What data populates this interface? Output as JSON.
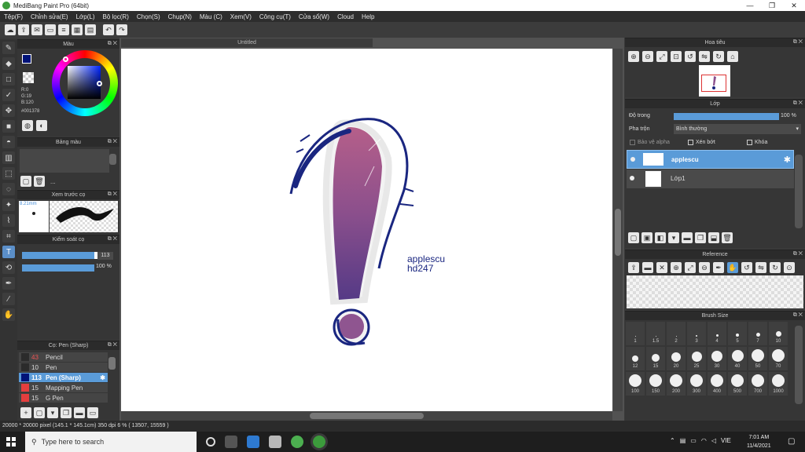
{
  "window": {
    "title": "MediBang Paint Pro (64bit)",
    "min": "—",
    "restore": "❐",
    "close": "✕"
  },
  "menu": [
    "Tệp(F)",
    "Chỉnh sửa(E)",
    "Lớp(L)",
    "Bộ lọc(R)",
    "Chọn(S)",
    "Chụp(N)",
    "Màu (C)",
    "Xem(V)",
    "Công cụ(T)",
    "Cửa sổ(W)",
    "Cloud",
    "Help"
  ],
  "canvas": {
    "tab_title": "Untitled",
    "text_line1": "applescu",
    "text_line2": "hd247"
  },
  "color_panel": {
    "title": "Màu",
    "r": "R:0",
    "g": "G:19",
    "b": "B:120",
    "hex": "#001378",
    "fg_color": "#001378",
    "bg_color": "#e43e3e"
  },
  "palette_panel": {
    "title": "Bảng màu",
    "more": "..."
  },
  "brush_preview_panel": {
    "title": "Xem trước cọ",
    "size": "8.21mm"
  },
  "brush_control_panel": {
    "title": "Kiểm soát cọ",
    "size_value": "113",
    "opacity_value": "100 %"
  },
  "brush_list_panel": {
    "title": "Cọ: Pen (Sharp)",
    "items": [
      {
        "size": "43",
        "name": "Pencil",
        "color": "#2b2b2b"
      },
      {
        "size": "10",
        "name": "Pen",
        "color": "#2b2b2b"
      },
      {
        "size": "113",
        "name": "Pen (Sharp)",
        "color": "#001378"
      },
      {
        "size": "15",
        "name": "Mapping Pen",
        "color": "#e43e3e"
      },
      {
        "size": "15",
        "name": "G Pen",
        "color": "#e43e3e"
      }
    ]
  },
  "navigator_panel": {
    "title": "Hoa tiêu"
  },
  "layer_panel": {
    "title": "Lớp",
    "opacity_label": "Độ trong",
    "opacity_value": "100 %",
    "blend_label": "Pha trộn",
    "blend_value": "Bình thường",
    "protect_alpha": "Bảo vệ alpha",
    "clipping": "Xén bớt",
    "lock": "Khóa",
    "layers": [
      {
        "name": "applescu",
        "selected": true
      },
      {
        "name": "Lớp1",
        "selected": false
      }
    ]
  },
  "reference_panel": {
    "title": "Reference"
  },
  "brush_size_panel": {
    "title": "Brush Size",
    "sizes": [
      "1",
      "1.5",
      "2",
      "3",
      "4",
      "5",
      "7",
      "10",
      "12",
      "15",
      "20",
      "25",
      "30",
      "40",
      "50",
      "70",
      "100",
      "150",
      "200",
      "300",
      "400",
      "500",
      "700",
      "1000"
    ]
  },
  "status": {
    "text": "20000 * 20000 pixel   (145.1 * 145.1cm)   350 dpi   6 %   ( 13507, 15559 )"
  },
  "taskbar": {
    "search_placeholder": "Type here to search",
    "lang": "VIE",
    "time": "7:01 AM",
    "date": "11/4/2021"
  }
}
